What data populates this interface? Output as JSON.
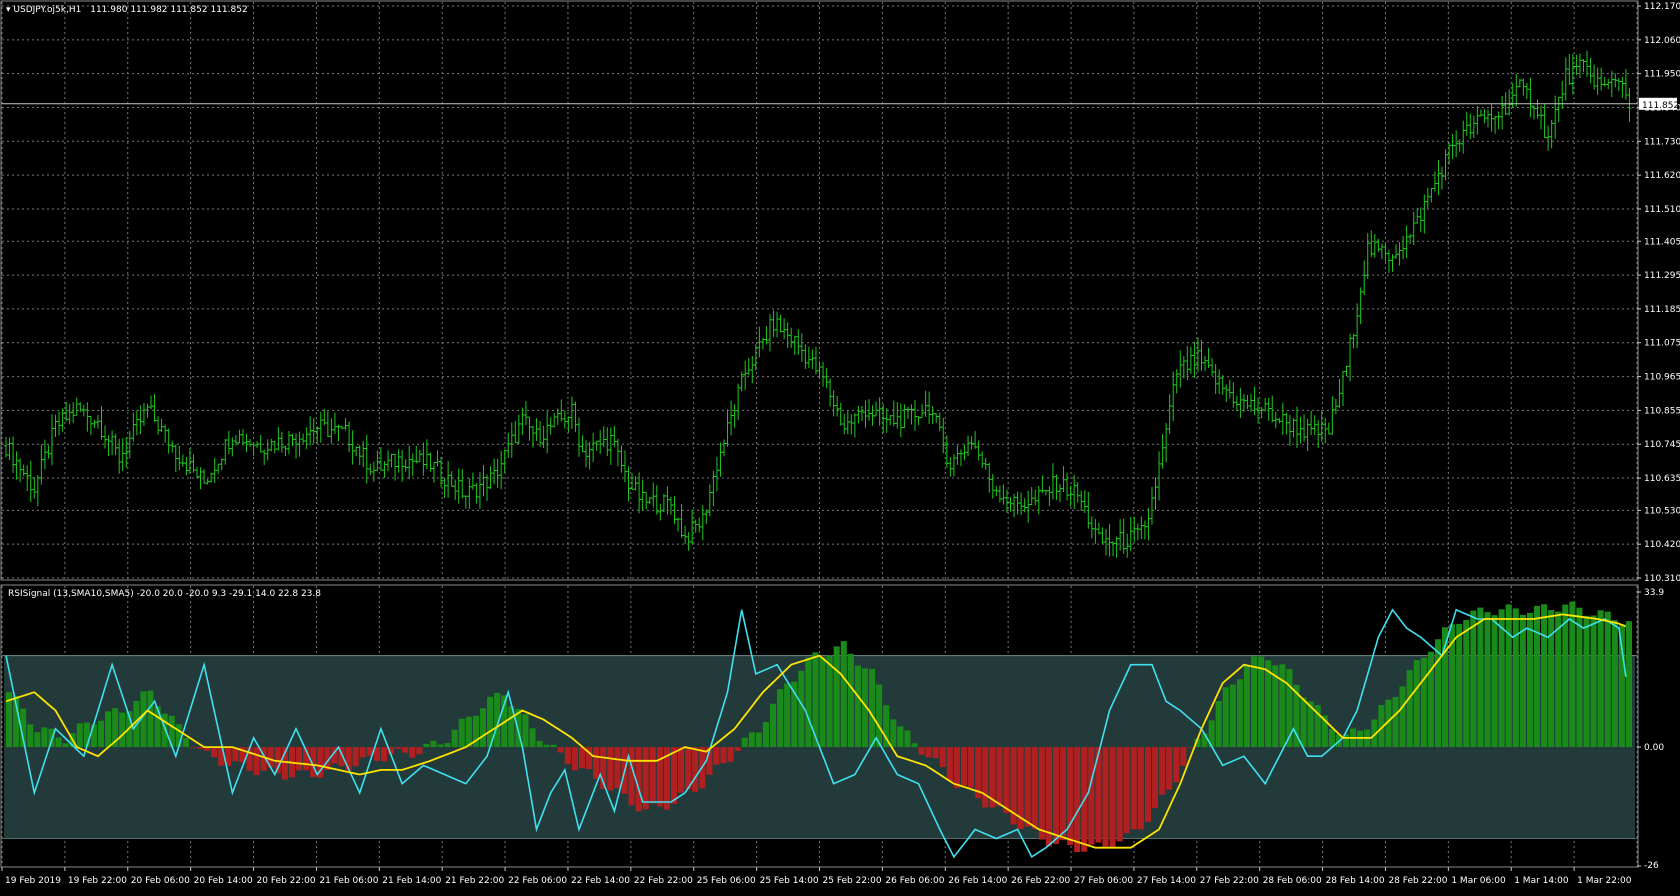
{
  "main_window": {
    "symbol_header": "USDJPY.oj5k,H1",
    "ohlc_header": "111.980 111.982 111.852 111.852",
    "current_price_label": "111.852",
    "price_axis_labels": [
      "112.170",
      "112.060",
      "111.950",
      "111.840",
      "111.730",
      "111.620",
      "111.510",
      "111.405",
      "111.295",
      "111.185",
      "111.075",
      "110.965",
      "110.855",
      "110.745",
      "110.635",
      "110.530",
      "110.420",
      "110.310"
    ]
  },
  "indicator_window": {
    "header": "RSISignal (13,SMA10,SMA5) -20.0 20.0 -20.0 9.3 -29.1 14.0 22.8 23.8",
    "axis_labels": [
      "33.9",
      "0.00",
      "-26"
    ]
  },
  "time_axis_labels": [
    "19 Feb 2019",
    "19 Feb 22:00",
    "20 Feb 06:00",
    "20 Feb 14:00",
    "20 Feb 22:00",
    "21 Feb 06:00",
    "21 Feb 14:00",
    "21 Feb 22:00",
    "22 Feb 06:00",
    "22 Feb 14:00",
    "22 Feb 22:00",
    "25 Feb 06:00",
    "25 Feb 14:00",
    "25 Feb 22:00",
    "26 Feb 06:00",
    "26 Feb 14:00",
    "26 Feb 22:00",
    "27 Feb 06:00",
    "27 Feb 14:00",
    "27 Feb 22:00",
    "28 Feb 06:00",
    "28 Feb 14:00",
    "28 Feb 22:00",
    "1 Mar 06:00",
    "1 Mar 14:00",
    "1 Mar 22:00"
  ],
  "colors": {
    "background": "#000000",
    "grid": "#7a7a7a",
    "bar": "#1fc81f",
    "rsi_line": "#3fe0f0",
    "signal_line": "#ffe400",
    "hist_positive": "#1a8a1a",
    "hist_negative": "#b02020",
    "band": "#223a3a",
    "axis_text": "#ffffff"
  },
  "chart_data": [
    {
      "type": "ohlc",
      "symbol": "USDJPY.oj5k",
      "timeframe": "H1",
      "ylim": [
        110.31,
        112.17
      ],
      "last_close": 111.852,
      "close_path": [
        [
          0,
          110.74
        ],
        [
          8,
          110.6
        ],
        [
          14,
          110.8
        ],
        [
          20,
          110.86
        ],
        [
          26,
          110.82
        ],
        [
          32,
          110.7
        ],
        [
          40,
          110.86
        ],
        [
          48,
          110.72
        ],
        [
          56,
          110.62
        ],
        [
          64,
          110.78
        ],
        [
          72,
          110.74
        ],
        [
          80,
          110.76
        ],
        [
          88,
          110.8
        ],
        [
          96,
          110.78
        ],
        [
          104,
          110.66
        ],
        [
          112,
          110.7
        ],
        [
          120,
          110.68
        ],
        [
          130,
          110.58
        ],
        [
          138,
          110.64
        ],
        [
          146,
          110.82
        ],
        [
          150,
          110.77
        ],
        [
          160,
          110.85
        ],
        [
          163,
          110.72
        ],
        [
          171,
          110.76
        ],
        [
          176,
          110.62
        ],
        [
          180,
          110.56
        ],
        [
          188,
          110.55
        ],
        [
          192,
          110.44
        ],
        [
          197,
          110.5
        ],
        [
          201,
          110.68
        ],
        [
          209,
          110.98
        ],
        [
          217,
          111.14
        ],
        [
          223,
          111.08
        ],
        [
          231,
          110.96
        ],
        [
          237,
          110.8
        ],
        [
          243,
          110.86
        ],
        [
          249,
          110.82
        ],
        [
          255,
          110.83
        ],
        [
          261,
          110.87
        ],
        [
          267,
          110.68
        ],
        [
          273,
          110.76
        ],
        [
          279,
          110.61
        ],
        [
          285,
          110.55
        ],
        [
          291,
          110.56
        ],
        [
          297,
          110.62
        ],
        [
          303,
          110.58
        ],
        [
          309,
          110.43
        ],
        [
          316,
          110.43
        ],
        [
          322,
          110.46
        ],
        [
          327,
          110.72
        ],
        [
          331,
          110.98
        ],
        [
          337,
          111.02
        ],
        [
          343,
          110.94
        ],
        [
          349,
          110.88
        ],
        [
          355,
          110.86
        ],
        [
          361,
          110.82
        ],
        [
          369,
          110.78
        ],
        [
          374,
          110.79
        ],
        [
          379,
          111.0
        ],
        [
          385,
          111.38
        ],
        [
          391,
          111.36
        ],
        [
          397,
          111.42
        ],
        [
          401,
          111.52
        ],
        [
          409,
          111.72
        ],
        [
          417,
          111.8
        ],
        [
          422,
          111.82
        ],
        [
          428,
          111.9
        ],
        [
          432,
          111.86
        ],
        [
          436,
          111.74
        ],
        [
          441,
          111.94
        ],
        [
          446,
          111.97
        ],
        [
          452,
          111.9
        ],
        [
          456,
          111.94
        ],
        [
          459,
          111.86
        ]
      ]
    },
    {
      "type": "line",
      "indicator": "RSISignal (13,SMA10,SMA5)",
      "ylim": [
        -26,
        33.9
      ],
      "levels": [
        -20,
        20
      ],
      "series": [
        {
          "role": "rsi",
          "points": [
            [
              0,
              20
            ],
            [
              8,
              -10
            ],
            [
              14,
              4
            ],
            [
              22,
              -2
            ],
            [
              30,
              18
            ],
            [
              36,
              4
            ],
            [
              42,
              10
            ],
            [
              48,
              -2
            ],
            [
              56,
              18
            ],
            [
              64,
              -10
            ],
            [
              70,
              2
            ],
            [
              76,
              -6
            ],
            [
              82,
              4
            ],
            [
              88,
              -6
            ],
            [
              94,
              0
            ],
            [
              100,
              -10
            ],
            [
              106,
              4
            ],
            [
              112,
              -8
            ],
            [
              118,
              -4
            ],
            [
              124,
              -6
            ],
            [
              130,
              -8
            ],
            [
              136,
              -2
            ],
            [
              142,
              12
            ],
            [
              146,
              0
            ],
            [
              150,
              -18
            ],
            [
              154,
              -10
            ],
            [
              158,
              -5
            ],
            [
              162,
              -18
            ],
            [
              168,
              -6
            ],
            [
              172,
              -14
            ],
            [
              176,
              -2
            ],
            [
              180,
              -12
            ],
            [
              188,
              -12
            ],
            [
              192,
              -10
            ],
            [
              198,
              -3
            ],
            [
              204,
              12
            ],
            [
              208,
              30
            ],
            [
              212,
              16
            ],
            [
              218,
              18
            ],
            [
              226,
              8
            ],
            [
              234,
              -8
            ],
            [
              240,
              -6
            ],
            [
              246,
              2
            ],
            [
              252,
              -6
            ],
            [
              258,
              -8
            ],
            [
              264,
              -18
            ],
            [
              268,
              -24
            ],
            [
              274,
              -18
            ],
            [
              280,
              -20
            ],
            [
              286,
              -18
            ],
            [
              290,
              -24
            ],
            [
              294,
              -22
            ],
            [
              300,
              -18
            ],
            [
              306,
              -10
            ],
            [
              312,
              8
            ],
            [
              318,
              18
            ],
            [
              324,
              18
            ],
            [
              328,
              10
            ],
            [
              332,
              8
            ],
            [
              338,
              4
            ],
            [
              344,
              -4
            ],
            [
              350,
              -2
            ],
            [
              356,
              -8
            ],
            [
              364,
              4
            ],
            [
              368,
              -2
            ],
            [
              372,
              -2
            ],
            [
              378,
              2
            ],
            [
              382,
              8
            ],
            [
              388,
              24
            ],
            [
              392,
              30
            ],
            [
              396,
              26
            ],
            [
              400,
              24
            ],
            [
              406,
              20
            ],
            [
              410,
              30
            ],
            [
              416,
              28
            ],
            [
              420,
              28
            ],
            [
              426,
              24
            ],
            [
              430,
              26
            ],
            [
              436,
              24
            ],
            [
              442,
              28
            ],
            [
              446,
              26
            ],
            [
              452,
              28
            ],
            [
              456,
              26
            ],
            [
              459,
              10
            ]
          ]
        },
        {
          "role": "signal",
          "points": [
            [
              0,
              10
            ],
            [
              8,
              12
            ],
            [
              14,
              8
            ],
            [
              20,
              0
            ],
            [
              26,
              -2
            ],
            [
              32,
              2
            ],
            [
              40,
              8
            ],
            [
              48,
              4
            ],
            [
              56,
              0
            ],
            [
              64,
              0
            ],
            [
              76,
              -3
            ],
            [
              88,
              -4
            ],
            [
              100,
              -6
            ],
            [
              106,
              -5
            ],
            [
              112,
              -5
            ],
            [
              120,
              -3
            ],
            [
              130,
              0
            ],
            [
              138,
              4
            ],
            [
              146,
              8
            ],
            [
              152,
              6
            ],
            [
              160,
              2
            ],
            [
              166,
              -2
            ],
            [
              176,
              -3
            ],
            [
              184,
              -3
            ],
            [
              192,
              0
            ],
            [
              198,
              -1
            ],
            [
              206,
              4
            ],
            [
              214,
              12
            ],
            [
              222,
              18
            ],
            [
              230,
              20
            ],
            [
              236,
              16
            ],
            [
              244,
              8
            ],
            [
              252,
              -2
            ],
            [
              260,
              -4
            ],
            [
              268,
              -8
            ],
            [
              276,
              -10
            ],
            [
              284,
              -14
            ],
            [
              292,
              -18
            ],
            [
              300,
              -20
            ],
            [
              308,
              -22
            ],
            [
              318,
              -22
            ],
            [
              326,
              -18
            ],
            [
              332,
              -8
            ],
            [
              338,
              4
            ],
            [
              344,
              14
            ],
            [
              350,
              18
            ],
            [
              356,
              17
            ],
            [
              362,
              14
            ],
            [
              370,
              8
            ],
            [
              378,
              2
            ],
            [
              386,
              2
            ],
            [
              394,
              8
            ],
            [
              402,
              16
            ],
            [
              410,
              24
            ],
            [
              418,
              28
            ],
            [
              426,
              28
            ],
            [
              432,
              28
            ],
            [
              440,
              29
            ],
            [
              450,
              28
            ],
            [
              456,
              27
            ],
            [
              459,
              26
            ]
          ]
        },
        {
          "role": "histogram",
          "points": [
            [
              0,
              12
            ],
            [
              8,
              4
            ],
            [
              16,
              2
            ],
            [
              24,
              6
            ],
            [
              32,
              8
            ],
            [
              40,
              12
            ],
            [
              48,
              4
            ],
            [
              56,
              -2
            ],
            [
              64,
              -4
            ],
            [
              76,
              -6
            ],
            [
              86,
              -6
            ],
            [
              96,
              -4
            ],
            [
              106,
              -2
            ],
            [
              116,
              -1
            ],
            [
              124,
              2
            ],
            [
              132,
              8
            ],
            [
              140,
              12
            ],
            [
              148,
              4
            ],
            [
              156,
              -2
            ],
            [
              164,
              -6
            ],
            [
              172,
              -10
            ],
            [
              180,
              -14
            ],
            [
              188,
              -12
            ],
            [
              196,
              -8
            ],
            [
              204,
              -2
            ],
            [
              212,
              4
            ],
            [
              220,
              14
            ],
            [
              228,
              20
            ],
            [
              236,
              22
            ],
            [
              244,
              16
            ],
            [
              252,
              4
            ],
            [
              260,
              -2
            ],
            [
              268,
              -8
            ],
            [
              276,
              -12
            ],
            [
              284,
              -16
            ],
            [
              292,
              -20
            ],
            [
              300,
              -22
            ],
            [
              308,
              -22
            ],
            [
              316,
              -20
            ],
            [
              324,
              -14
            ],
            [
              332,
              -4
            ],
            [
              338,
              4
            ],
            [
              344,
              12
            ],
            [
              350,
              18
            ],
            [
              356,
              20
            ],
            [
              362,
              16
            ],
            [
              370,
              8
            ],
            [
              378,
              2
            ],
            [
              386,
              6
            ],
            [
              394,
              14
            ],
            [
              402,
              22
            ],
            [
              410,
              28
            ],
            [
              418,
              30
            ],
            [
              426,
              30
            ],
            [
              432,
              30
            ],
            [
              440,
              31
            ],
            [
              450,
              29
            ],
            [
              456,
              28
            ],
            [
              459,
              27
            ]
          ]
        }
      ]
    }
  ]
}
